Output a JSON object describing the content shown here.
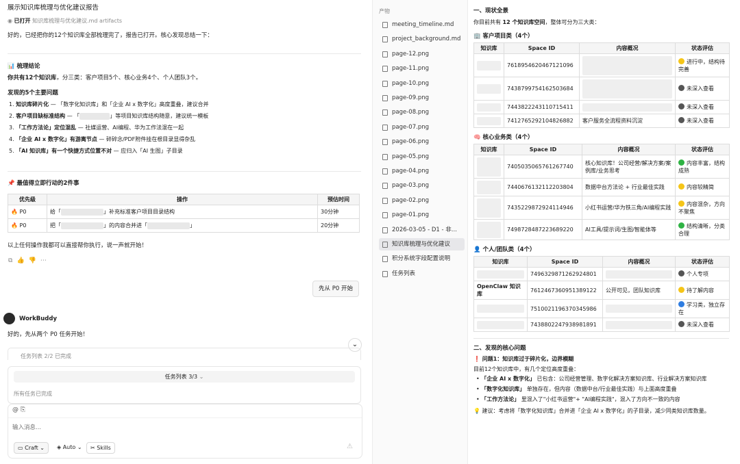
{
  "chat": {
    "title": "展示知识库梳理与优化建议报告",
    "opened_label": "已打开",
    "opened_file": "知识库梳理与优化建议.md",
    "opened_folder": "artifacts",
    "intro": "好的，已经把你的12个知识库全部梳理完了，报告已打开。核心发现总结一下：",
    "summary_heading": "📊 梳理结论",
    "summary_strong": "你共有12个知识库",
    "summary_rest": "，分三类：客户项目5个、核心业务4个、个人团队3个。",
    "issues_heading": "发现的5个主要问题",
    "issues": [
      {
        "num": "1.",
        "strong": "知识库碎片化",
        "rest": " — 「数字化知识库」和「企业 AI x 数字化」高度重叠，建议合并"
      },
      {
        "num": "2.",
        "strong": "客户项目缺标准结构",
        "rest_a": " — 「",
        "rest_b": "」等项目知识库结构随意，建议统一模板"
      },
      {
        "num": "3.",
        "strong": "「工作方法论」定位混乱",
        "rest": " — 社媒运营、AI编程、华为工作法混在一起"
      },
      {
        "num": "4.",
        "strong": "「企业 AI x 数字化」有游离节点",
        "rest": " — 碎碎念/PDF附件挂在根目录显得杂乱"
      },
      {
        "num": "5.",
        "strong": "「AI 知识库」有一个快捷方式位置不对",
        "rest": " — 应归入「AI 生图」子目录"
      }
    ],
    "actions_heading": "📌 最值得立即行动的2件事",
    "actions_table": {
      "headers": [
        "优先级",
        "操作",
        "预估时间"
      ],
      "rows": [
        {
          "priority": "🔥 P0",
          "op_a": "给「",
          "op_b": "」补充标准客户项目目录结构",
          "time": "30分钟"
        },
        {
          "priority": "🔥 P0",
          "op_a": "把「",
          "op_b": "」的内容合并进「",
          "op_c": "」",
          "time": "20分钟"
        }
      ]
    },
    "closing": "以上任何操作我都可以直接帮你执行，说一声就开始！",
    "user_bubble": "先从 P0 开始",
    "bot_name": "WorkBuddy",
    "bot_reply": "好的，先从两个 P0 任务开始！",
    "task_peek": "任务列表 2/2 已完成",
    "task_panel_title": "任务列表 3/3",
    "task_panel_status": "所有任务已完成",
    "input_placeholder": "输入消息...",
    "mode_craft": "Craft",
    "mode_auto": "Auto",
    "mode_skills": "Skills"
  },
  "sidebar": {
    "section": "产物",
    "items": [
      {
        "label": "meeting_timeline.md",
        "active": false
      },
      {
        "label": "project_background.md",
        "active": false
      },
      {
        "label": "page-12.png",
        "active": false
      },
      {
        "label": "page-11.png",
        "active": false
      },
      {
        "label": "page-10.png",
        "active": false
      },
      {
        "label": "page-09.png",
        "active": false
      },
      {
        "label": "page-08.png",
        "active": false
      },
      {
        "label": "page-07.png",
        "active": false
      },
      {
        "label": "page-06.png",
        "active": false
      },
      {
        "label": "page-05.png",
        "active": false
      },
      {
        "label": "page-04.png",
        "active": false
      },
      {
        "label": "page-03.png",
        "active": false
      },
      {
        "label": "page-02.png",
        "active": false
      },
      {
        "label": "page-01.png",
        "active": false
      },
      {
        "label": "2026-03-05 - D1 - 非...",
        "active": false
      },
      {
        "label": "知识库梳理与优化建议",
        "active": true
      },
      {
        "label": "积分系统字段配置说明",
        "active": false
      },
      {
        "label": "任务列表",
        "active": false
      }
    ]
  },
  "doc": {
    "h1": "一、现状全景",
    "overview_a": "你目前共有 ",
    "overview_b": "12 个知识库空间",
    "overview_c": "，整体可分为三大类：",
    "sec1": "🏢 客户项目类（4个）",
    "t1_headers": [
      "知识库",
      "Space ID",
      "内容概况",
      "状态评估"
    ],
    "t1_rows": [
      {
        "id": "7618954620467121096",
        "content": "",
        "status": "进行中，结构待完善",
        "color": "#f5c518"
      },
      {
        "id": "7438799754162503684",
        "content": "",
        "status": "未深入查看",
        "color": "#555555"
      },
      {
        "id": "7443822243110715411",
        "content": "",
        "status": "未深入查看",
        "color": "#555555"
      },
      {
        "id": "7412765292104826882",
        "content": "客户服务全流程资料沉淀",
        "status": "未深入查看",
        "color": "#555555"
      }
    ],
    "sec2": "🧠 核心业务类（4个）",
    "t2_headers": [
      "知识库",
      "Space ID",
      "内容概况",
      "状态评估"
    ],
    "t2_rows": [
      {
        "id": "7405035065761267740",
        "content": "核心知识库！公司经营/解决方案/案例库/业务思考",
        "status": "内容丰富，结构成熟",
        "color": "#2fb344"
      },
      {
        "id": "7440676132112203804",
        "content": "数据中台方法论 + 行业最佳实践",
        "status": "内容较精简",
        "color": "#f5c518"
      },
      {
        "id": "7435229872924114946",
        "content": "小红书运营/华为铁三角/AI编程实践",
        "status": "内容混杂，方向不聚焦",
        "color": "#f5c518"
      },
      {
        "id": "7498728487223689220",
        "content": "AI工具/提示词/生图/智能体等",
        "status": "结构清晰，分类合理",
        "color": "#2fb344"
      }
    ],
    "sec3": "👤 个人/团队类（4个）",
    "t3_headers": [
      "知识库",
      "Space ID",
      "内容概况",
      "状态评估"
    ],
    "t3_rows": [
      {
        "name": "",
        "id": "7496329871262924801",
        "content": "",
        "status": "个人专项",
        "color": "#555555"
      },
      {
        "name": "OpenClaw 知识库",
        "id": "7612467360951389122",
        "content": "公开可见，团队知识库",
        "status": "待了解内容",
        "color": "#f5c518"
      },
      {
        "name": "",
        "id": "7510021196370345986",
        "content": "",
        "status": "学习类，独立存在",
        "color": "#2f7de1"
      },
      {
        "name": "",
        "id": "7438802247938981891",
        "content": "",
        "status": "未深入查看",
        "color": "#555555"
      }
    ],
    "h2": "二、发现的核心问题",
    "problem1": "❗ 问题1：知识库过于碎片化，边界模糊",
    "problem1_desc": "目前12个知识库中，有几个定位高度重叠：",
    "bullets": [
      {
        "strong": "「企业 AI x 数字化」",
        "rest": " 已包含：公司经营管理、数字化解决方案知识库、行业解决方案知识库"
      },
      {
        "strong": "「数字化知识库」",
        "rest": " 单独存在，但内容（数据中台/行业最佳实践）与上面高度重叠"
      },
      {
        "strong": "「工作方法论」",
        "rest": " 里混入了\"小红书运营\"+ \"AI编程实践\"，混入了方向不一致的内容"
      }
    ],
    "suggest": "💡 建议：考虑将「数字化知识库」合并进「企业 AI x 数字化」的子目录，减少同类知识库数量。"
  }
}
